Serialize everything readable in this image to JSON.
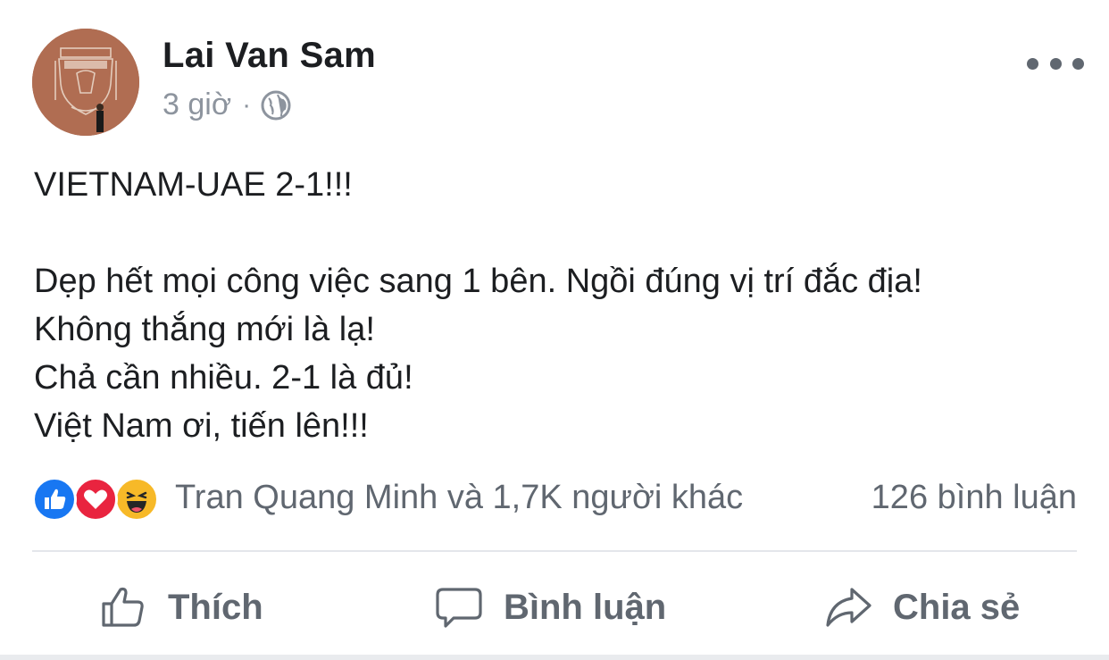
{
  "post": {
    "author": "Lai Van Sam",
    "time": "3 giờ",
    "separator": "·",
    "privacy_icon": "globe-icon",
    "more_icon": "more-options-icon",
    "lines": [
      "VIETNAM-UAE 2-1!!!",
      "",
      "Dẹp hết mọi công việc sang 1 bên. Ngồi đúng vị trí đắc địa!",
      "Không thắng mới là lạ!",
      "Chả cần nhiều. 2-1 là đủ!",
      "Việt Nam ơi, tiến lên!!!"
    ]
  },
  "reactions": {
    "icons": [
      "like-reaction-icon",
      "love-reaction-icon",
      "haha-reaction-icon"
    ],
    "summary": "Tran Quang Minh và 1,7K người khác",
    "comments": "126 bình luận"
  },
  "actions": {
    "like": "Thích",
    "comment": "Bình luận",
    "share": "Chia sẻ"
  },
  "colors": {
    "text": "#1c1e21",
    "secondary": "#606770",
    "meta": "#8d949e",
    "like_blue": "#1877f2",
    "love_red": "#e9243f",
    "haha_yellow": "#f7b928"
  }
}
